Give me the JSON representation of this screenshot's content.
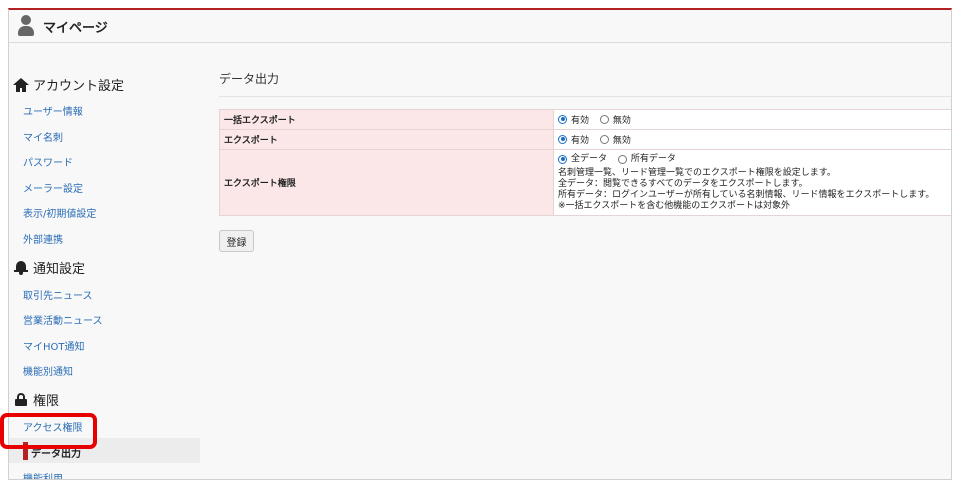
{
  "header": {
    "title": "マイページ"
  },
  "sidebar": {
    "sections": [
      {
        "title": "アカウント設定",
        "items": [
          "ユーザー情報",
          "マイ名刺",
          "パスワード",
          "メーラー設定",
          "表示/初期値設定",
          "外部連携"
        ]
      },
      {
        "title": "通知設定",
        "items": [
          "取引先ニュース",
          "営業活動ニュース",
          "マイHOT通知",
          "機能別通知"
        ]
      },
      {
        "title": "権限",
        "items": [
          "アクセス権限",
          "データ出力",
          "機能利用"
        ]
      }
    ],
    "active_item": "データ出力"
  },
  "main": {
    "title": "データ出力",
    "rows": [
      {
        "label": "一括エクスポート",
        "options": [
          "有効",
          "無効"
        ],
        "selected": "有効"
      },
      {
        "label": "エクスポート",
        "options": [
          "有効",
          "無効"
        ],
        "selected": "有効"
      },
      {
        "label": "エクスポート権限",
        "options": [
          "全データ",
          "所有データ"
        ],
        "selected": "全データ",
        "description": [
          "名刺管理一覧、リード管理一覧でのエクスポート権限を設定します。",
          "全データ：閲覧できるすべてのデータをエクスポートします。",
          "所有データ：ログインユーザーが所有している名刺情報、リード情報をエクスポートします。",
          "※一括エクスポートを含む他機能のエクスポートは対象外"
        ]
      }
    ],
    "submit_label": "登録"
  },
  "colors": {
    "accent": "#b22222",
    "label_bg": "#fbe7e8",
    "link": "#2a6db5",
    "highlight": "#e60000"
  }
}
